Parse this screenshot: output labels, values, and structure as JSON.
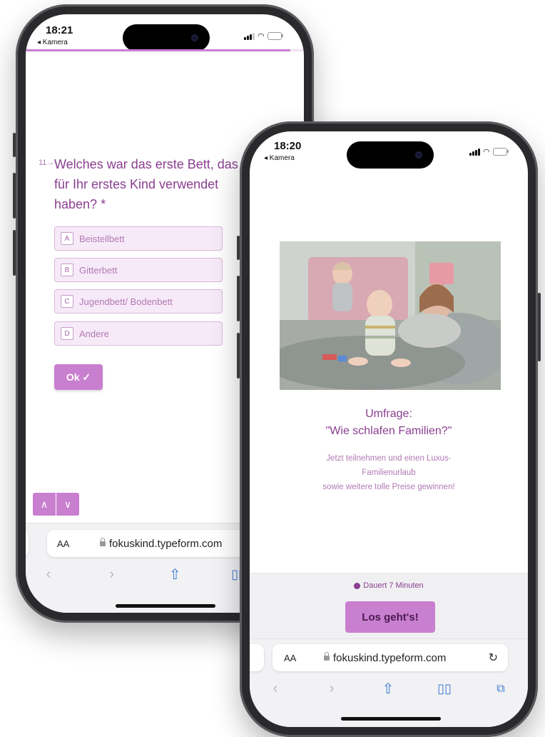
{
  "back_phone": {
    "time": "18:21",
    "back_label": "◂ Kamera",
    "question_number": "11→",
    "question": "Welches war das erste Bett, das Sie für Ihr erstes Kind verwendet haben? *",
    "choices": [
      {
        "key": "A",
        "label": "Beistellbett"
      },
      {
        "key": "B",
        "label": "Gitterbett"
      },
      {
        "key": "C",
        "label": "Jugendbett/ Bodenbett"
      },
      {
        "key": "D",
        "label": "Andere"
      }
    ],
    "ok_label": "Ok ✓",
    "url": "fokuskind.typeform.com",
    "aa": "AA",
    "progress": 0.95
  },
  "front_phone": {
    "time": "18:20",
    "back_label": "◂ Kamera",
    "title_line1": "Umfrage:",
    "title_line2": "\"Wie schlafen Familien?\"",
    "description_line1": "Jetzt teilnehmen und einen Luxus-",
    "description_line2": "Familienurlaub",
    "description_line3": "sowie weitere tolle Preise gewinnen!",
    "duration": "Dauert 7 Minuten",
    "start_label": "Los geht's!",
    "url": "fokuskind.typeform.com",
    "aa": "AA"
  },
  "colors": {
    "accent": "#c97fcf",
    "accent_text": "#9a4a9f",
    "light_purple": "#f7eaf8"
  }
}
